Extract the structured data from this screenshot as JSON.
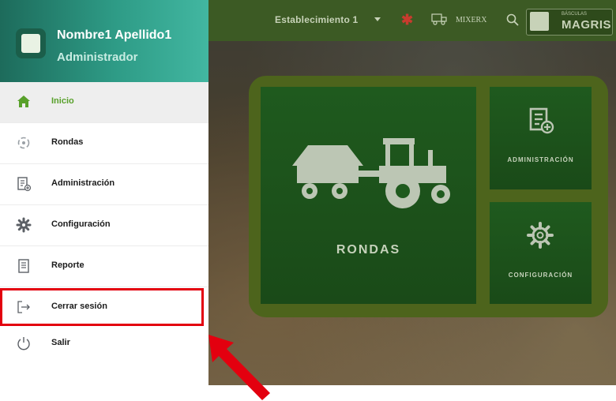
{
  "user": {
    "name": "Nombre1 Apellido1",
    "role": "Administrador"
  },
  "menu": [
    {
      "label": "Inicio",
      "icon": "home-icon",
      "active": true
    },
    {
      "label": "Rondas",
      "icon": "rondas-icon"
    },
    {
      "label": "Administración",
      "icon": "document-add-icon"
    },
    {
      "label": "Configuración",
      "icon": "gear-icon"
    },
    {
      "label": "Reporte",
      "icon": "report-icon"
    },
    {
      "label": "Cerrar sesión",
      "icon": "logout-icon"
    },
    {
      "label": "Salir",
      "icon": "power-icon"
    }
  ],
  "topbar": {
    "establishment": "Establecimiento 1",
    "mixer_label": "MIXERX",
    "logo_small": "BÁSCULAS",
    "logo_big": "MAGRIS"
  },
  "tiles": {
    "rondas": "RONDAS",
    "administracion": "ADMINISTRACIÓN",
    "configuracion": "CONFIGURACIÓN"
  },
  "colors": {
    "sidebar_header": "#2e9b86",
    "active_item": "#58a02a",
    "tile_green": "#1f5a1e",
    "frame_green": "#4d641c",
    "highlight": "#e3000f",
    "topbar": "#3c5a24"
  }
}
